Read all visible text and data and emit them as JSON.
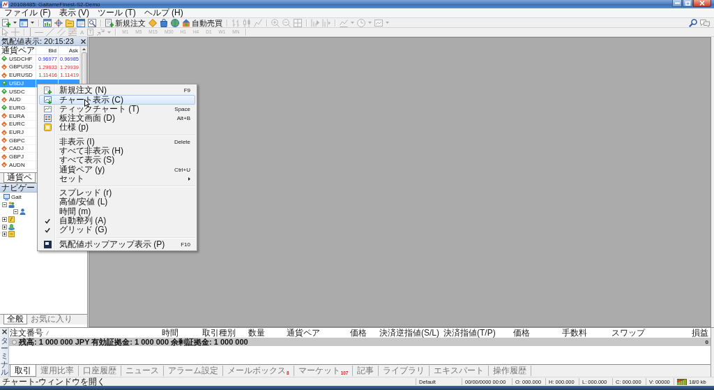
{
  "window": {
    "title": "20108485: GaitameFinest-S2-Demo"
  },
  "menu_bar": [
    "ファイル (F)",
    "表示 (V)",
    "ツール (T)",
    "ヘルプ (H)"
  ],
  "toolbar": {
    "new_order": "新規注文",
    "auto_trading": "自動売買",
    "chart_buttons_disabled": true
  },
  "drawing_toolbar": {
    "disabled": true,
    "text_tool": "A",
    "label_tool": "T",
    "timeframes": [
      "M1",
      "M5",
      "M15",
      "M30",
      "H1",
      "H4",
      "D1",
      "W1",
      "MN"
    ]
  },
  "market_watch": {
    "title": "気配値表示: 20:15:23",
    "columns": [
      "通貨ペア",
      "Bid",
      "Ask"
    ],
    "rows": [
      {
        "symbol": "USDCHF",
        "bid": "0.96977",
        "ask": "0.96985",
        "rising": true,
        "selected": false
      },
      {
        "symbol": "GBPUSD",
        "bid": "1.29933",
        "ask": "1.29939",
        "rising": false,
        "selected": false
      },
      {
        "symbol": "EURUSD",
        "bid": "1.11416",
        "ask": "1.11419",
        "rising": false,
        "selected": false
      },
      {
        "symbol": "USDJ",
        "rising": true,
        "selected": true
      },
      {
        "symbol": "USDC",
        "rising": true,
        "selected": false
      },
      {
        "symbol": "AUD",
        "rising": false,
        "selected": false
      },
      {
        "symbol": "EURG",
        "rising": true,
        "selected": false
      },
      {
        "symbol": "EURA",
        "rising": false,
        "selected": false
      },
      {
        "symbol": "EURC",
        "rising": false,
        "selected": false
      },
      {
        "symbol": "EURJ",
        "rising": false,
        "selected": false
      },
      {
        "symbol": "GBPC",
        "rising": false,
        "selected": false
      },
      {
        "symbol": "CADJ",
        "rising": false,
        "selected": false
      },
      {
        "symbol": "GBPJ",
        "rising": false,
        "selected": false
      },
      {
        "symbol": "AUDN",
        "rising": false,
        "selected": false
      }
    ],
    "tabs": [
      {
        "label": "通貨ペ",
        "selected": true
      }
    ]
  },
  "navigator": {
    "title": "ナビゲー",
    "tree": [
      {
        "label": "Gait",
        "children": [
          {
            "expanded": true,
            "children": [
              {
                "expanded": true
              }
            ]
          },
          {
            "expanded": false
          },
          {
            "expanded": false
          },
          {
            "expanded": false
          }
        ]
      }
    ],
    "tabs": [
      {
        "label": "全般",
        "selected": true
      },
      {
        "label": "お気に入り",
        "selected": false
      }
    ]
  },
  "context_menu": {
    "items": [
      {
        "kind": "item",
        "label": "新規注文 (N)",
        "shortcut": "F9",
        "checked": false,
        "selected": false,
        "submenu": false
      },
      {
        "kind": "item",
        "label": "チャート表示 (C)",
        "checked": false,
        "selected": true,
        "submenu": false
      },
      {
        "kind": "item",
        "label": "ティックチャート (T)",
        "shortcut": "Space",
        "checked": false,
        "selected": false,
        "submenu": false
      },
      {
        "kind": "item",
        "label": "板注文画面 (D)",
        "shortcut": "Alt+B",
        "checked": false,
        "selected": false,
        "submenu": false
      },
      {
        "kind": "item",
        "label": "仕様 (p)",
        "checked": false,
        "selected": false,
        "submenu": false
      },
      {
        "kind": "separator"
      },
      {
        "kind": "item",
        "label": "非表示 (I)",
        "shortcut": "Delete",
        "checked": false,
        "selected": false,
        "submenu": false
      },
      {
        "kind": "item",
        "label": "すべて非表示 (H)",
        "checked": false,
        "selected": false,
        "submenu": false
      },
      {
        "kind": "item",
        "label": "すべて表示 (S)",
        "checked": false,
        "selected": false,
        "submenu": false
      },
      {
        "kind": "item",
        "label": "通貨ペア (y)",
        "shortcut": "Ctrl+U",
        "checked": false,
        "selected": false,
        "submenu": false
      },
      {
        "kind": "item",
        "label": "セット",
        "checked": false,
        "selected": false,
        "submenu": true
      },
      {
        "kind": "separator"
      },
      {
        "kind": "item",
        "label": "スプレッド (r)",
        "checked": false,
        "selected": false,
        "submenu": false
      },
      {
        "kind": "item",
        "label": "高値/安値 (L)",
        "checked": false,
        "selected": false,
        "submenu": false
      },
      {
        "kind": "item",
        "label": "時間 (m)",
        "checked": false,
        "selected": false,
        "submenu": false
      },
      {
        "kind": "item",
        "label": "自動整列 (A)",
        "checked": true,
        "selected": false,
        "submenu": false
      },
      {
        "kind": "item",
        "label": "グリッド (G)",
        "checked": true,
        "selected": false,
        "submenu": false
      },
      {
        "kind": "separator"
      },
      {
        "kind": "item",
        "label": "気配値ポップアップ表示 (P)",
        "shortcut": "F10",
        "checked": false,
        "selected": false,
        "submenu": false
      }
    ]
  },
  "terminal": {
    "side_label": "ターミナル",
    "columns": [
      "注文番号",
      "時間",
      "取引種別",
      "数量",
      "通貨ペア",
      "価格",
      "決済逆指値(S/L)",
      "決済指値(T/P)",
      "価格",
      "手数料",
      "スワップ",
      "損益"
    ],
    "balance": "残高: 1 000 000 JPY 有効証拠金: 1 000 000 余剰証拠金: 1 000 000",
    "profit": "0",
    "tabs": [
      {
        "label": "取引",
        "selected": true
      },
      {
        "label": "運用比率",
        "selected": false
      },
      {
        "label": "口座履歴",
        "selected": false
      },
      {
        "label": "ニュース",
        "selected": false
      },
      {
        "label": "アラーム設定",
        "selected": false
      },
      {
        "label": "メールボックス",
        "badge": "8",
        "selected": false
      },
      {
        "label": "マーケット",
        "badge": "107",
        "selected": false
      },
      {
        "label": "記事",
        "selected": false
      },
      {
        "label": "ライブラリ",
        "selected": false
      },
      {
        "label": "エキスパート",
        "selected": false
      },
      {
        "label": "操作履歴",
        "selected": false
      }
    ]
  },
  "status_bar": {
    "hint": "チャート-ウィンドウを開く",
    "profile": "Default",
    "datetime": "00/00/0000 00:00",
    "open": "O: 000.000",
    "high": "H: 000.000",
    "low": "L: 000.000",
    "close": "C: 000.000",
    "volume": "V: 00000",
    "traffic": "18/0 kb"
  }
}
